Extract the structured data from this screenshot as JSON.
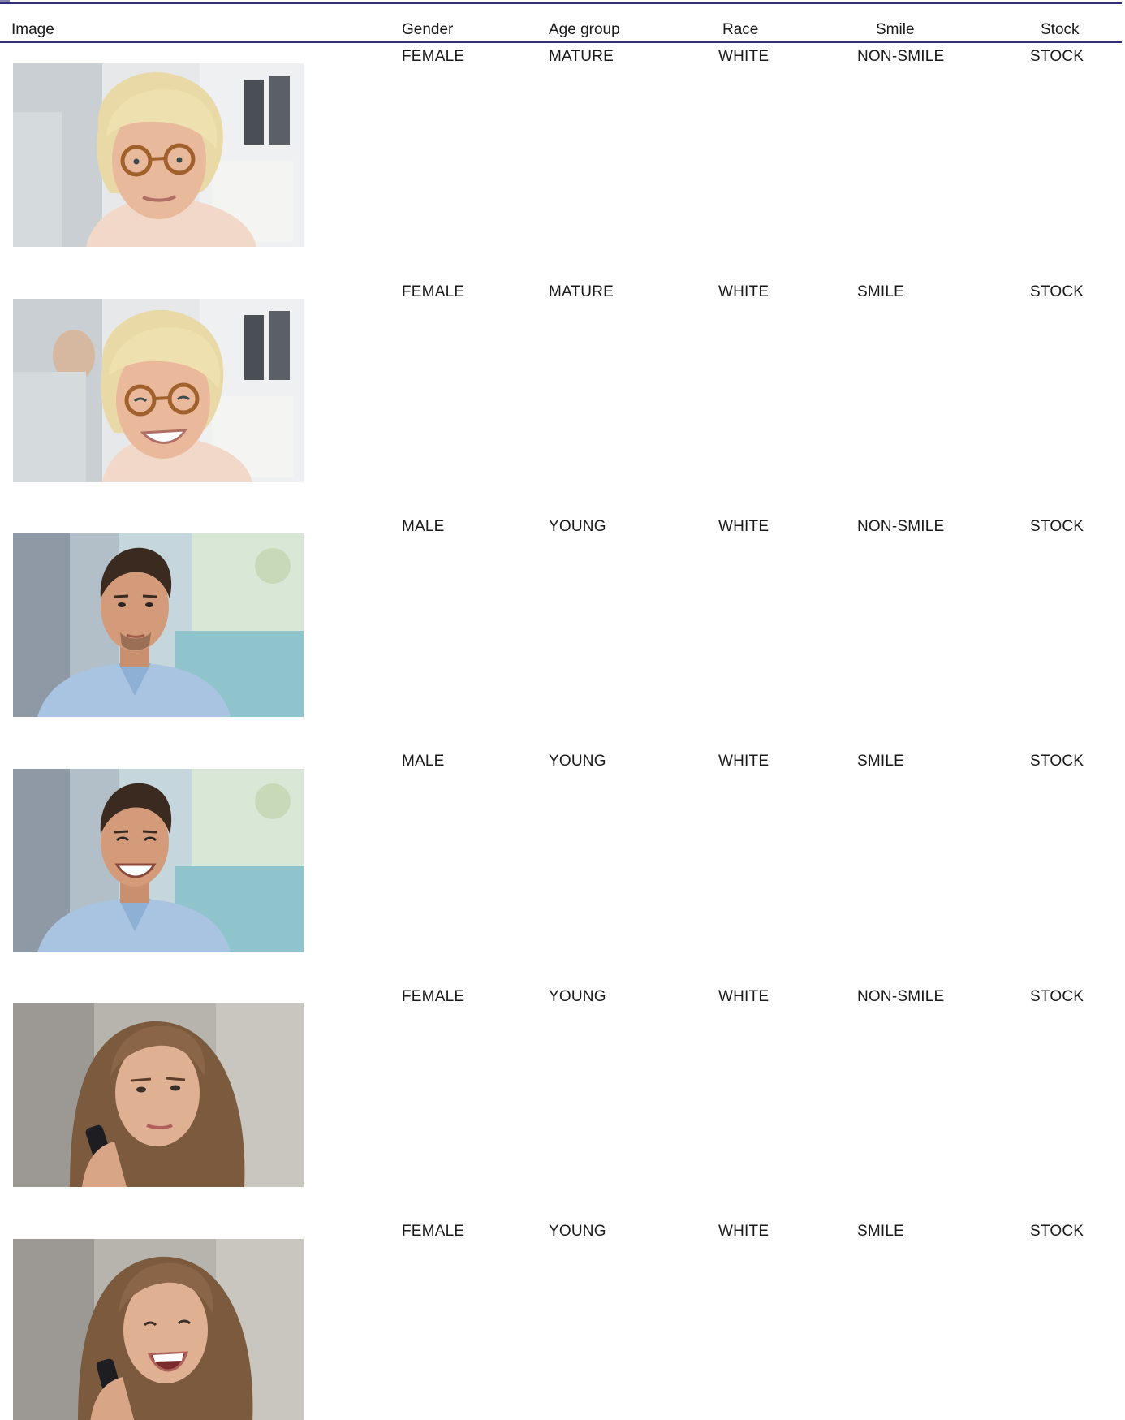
{
  "table": {
    "headers": {
      "image": "Image",
      "gender": "Gender",
      "age_group": "Age group",
      "race": "Race",
      "smile": "Smile",
      "stock": "Stock"
    },
    "rows": [
      {
        "photo": "mature-blonde-woman-glasses-office",
        "gender": "FEMALE",
        "age_group": "MATURE",
        "race": "WHITE",
        "smile": "NON-SMILE",
        "stock": "STOCK"
      },
      {
        "photo": "mature-blonde-woman-glasses-office-smiling",
        "gender": "FEMALE",
        "age_group": "MATURE",
        "race": "WHITE",
        "smile": "SMILE",
        "stock": "STOCK"
      },
      {
        "photo": "young-dark-haired-man-blue-shirt",
        "gender": "MALE",
        "age_group": "YOUNG",
        "race": "WHITE",
        "smile": "NON-SMILE",
        "stock": "STOCK"
      },
      {
        "photo": "young-dark-haired-man-blue-shirt-smiling",
        "gender": "MALE",
        "age_group": "YOUNG",
        "race": "WHITE",
        "smile": "SMILE",
        "stock": "STOCK"
      },
      {
        "photo": "young-brunette-woman-on-phone",
        "gender": "FEMALE",
        "age_group": "YOUNG",
        "race": "WHITE",
        "smile": "NON-SMILE",
        "stock": "STOCK"
      },
      {
        "photo": "young-brunette-woman-on-phone-laughing",
        "gender": "FEMALE",
        "age_group": "YOUNG",
        "race": "WHITE",
        "smile": "SMILE",
        "stock": "STOCK"
      }
    ]
  }
}
